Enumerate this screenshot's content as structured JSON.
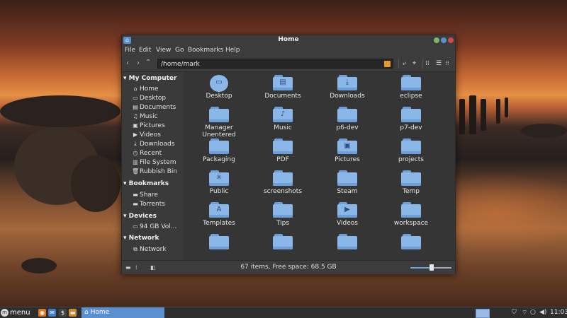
{
  "window": {
    "title": "Home",
    "menu": [
      "File",
      "Edit",
      "View",
      "Go",
      "Bookmarks",
      "Help"
    ],
    "location": "/home/mark",
    "status": "67 items, Free space: 68.5 GB",
    "zoom_fraction": 0.5
  },
  "sidebar": {
    "sections": [
      {
        "title": "My Computer",
        "items": [
          {
            "label": "Home",
            "icon": "home-icon"
          },
          {
            "label": "Desktop",
            "icon": "desktop-icon"
          },
          {
            "label": "Documents",
            "icon": "documents-icon"
          },
          {
            "label": "Music",
            "icon": "music-icon"
          },
          {
            "label": "Pictures",
            "icon": "pictures-icon"
          },
          {
            "label": "Videos",
            "icon": "videos-icon"
          },
          {
            "label": "Downloads",
            "icon": "downloads-icon"
          },
          {
            "label": "Recent",
            "icon": "recent-icon"
          },
          {
            "label": "File System",
            "icon": "filesystem-icon"
          },
          {
            "label": "Rubbish Bin",
            "icon": "trash-icon"
          }
        ]
      },
      {
        "title": "Bookmarks",
        "items": [
          {
            "label": "Share",
            "icon": "folder-icon"
          },
          {
            "label": "Torrents",
            "icon": "folder-icon"
          }
        ]
      },
      {
        "title": "Devices",
        "items": [
          {
            "label": "94 GB Vol...",
            "icon": "drive-icon"
          }
        ]
      },
      {
        "title": "Network",
        "items": [
          {
            "label": "Network",
            "icon": "network-icon"
          }
        ]
      }
    ]
  },
  "files": [
    {
      "name": "Desktop",
      "icon": "desktop-icon"
    },
    {
      "name": "Documents",
      "icon": "documents-icon"
    },
    {
      "name": "Downloads",
      "icon": "downloads-icon"
    },
    {
      "name": "eclipse",
      "icon": "folder-icon"
    },
    {
      "name": "Manager\nUnentered",
      "icon": "folder-icon"
    },
    {
      "name": "Music",
      "icon": "music-icon"
    },
    {
      "name": "p6-dev",
      "icon": "folder-icon"
    },
    {
      "name": "p7-dev",
      "icon": "folder-icon"
    },
    {
      "name": "Packaging",
      "icon": "folder-icon"
    },
    {
      "name": "PDF",
      "icon": "folder-icon"
    },
    {
      "name": "Pictures",
      "icon": "pictures-icon"
    },
    {
      "name": "projects",
      "icon": "folder-icon"
    },
    {
      "name": "Public",
      "icon": "public-icon"
    },
    {
      "name": "screenshots",
      "icon": "folder-icon"
    },
    {
      "name": "Steam",
      "icon": "folder-icon"
    },
    {
      "name": "Temp",
      "icon": "folder-icon"
    },
    {
      "name": "Templates",
      "icon": "templates-icon"
    },
    {
      "name": "Tips",
      "icon": "folder-icon"
    },
    {
      "name": "Videos",
      "icon": "videos-icon"
    },
    {
      "name": "workspace",
      "icon": "folder-icon"
    },
    {
      "name": "",
      "icon": "folder-icon"
    },
    {
      "name": "",
      "icon": "folder-icon"
    },
    {
      "name": "",
      "icon": "folder-icon"
    },
    {
      "name": "",
      "icon": "folder-icon"
    }
  ],
  "panel": {
    "menu_label": "menu",
    "task_label": "Home",
    "clock": "11:03"
  },
  "colors": {
    "accent": "#5a8fd0",
    "folder": "#8bb6e8"
  }
}
